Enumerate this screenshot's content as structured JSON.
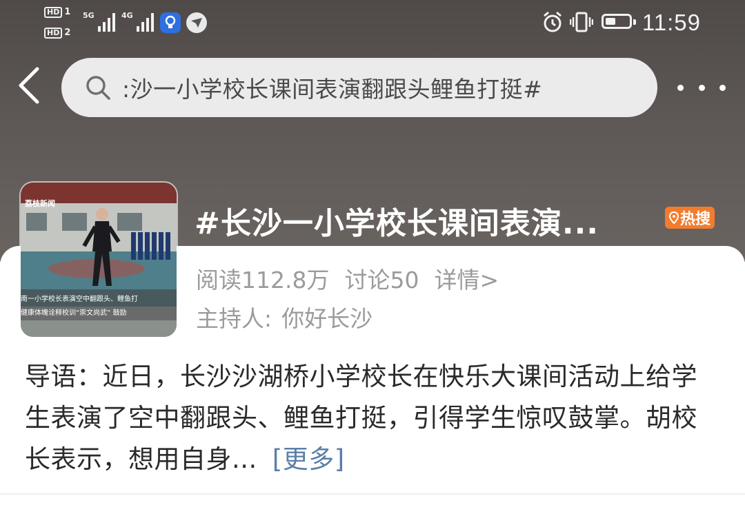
{
  "status_bar": {
    "hd1": "HD",
    "hd1_sim": "1",
    "hd2": "HD",
    "hd2_sim": "2",
    "net1": "5G",
    "net2": "4G",
    "time": "11:59",
    "battery_level": 0.45,
    "icons": [
      "alarm-icon",
      "vibrate-icon",
      "battery-icon"
    ]
  },
  "nav": {
    "back_icon": "chevron-left-icon",
    "search_query": ":沙一小学校长课间表演翻跟头鲤鱼打挺#",
    "more_icon": "more-dots-icon"
  },
  "topic": {
    "title": "#长沙一小学校长课间表演...",
    "hot_badge": "热搜",
    "thumbnail_caption_top": "荔枝新闻",
    "thumbnail_caption_line1": "南一小学校长表演空中翻跟头、鲤鱼打",
    "thumbnail_caption_line2": "健康体魄诠释校训“崇文尚武” 鼓励",
    "reads": "阅读112.8万",
    "discussions": "讨论50",
    "details": "详情>",
    "host_label": "主持人:",
    "host_name": "你好长沙"
  },
  "intro": {
    "text": "导语：近日，长沙沙湖桥小学校长在快乐大课间活动上给学生表演了空中翻跟头、鲤鱼打挺，引得学生惊叹鼓掌。胡校长表示，想用自身...",
    "more": "[更多]"
  },
  "colors": {
    "header_bg": "#5a5553",
    "hot_badge": "#f27c2e",
    "link": "#5a7fa8",
    "meta_text": "#9b9b9b"
  }
}
